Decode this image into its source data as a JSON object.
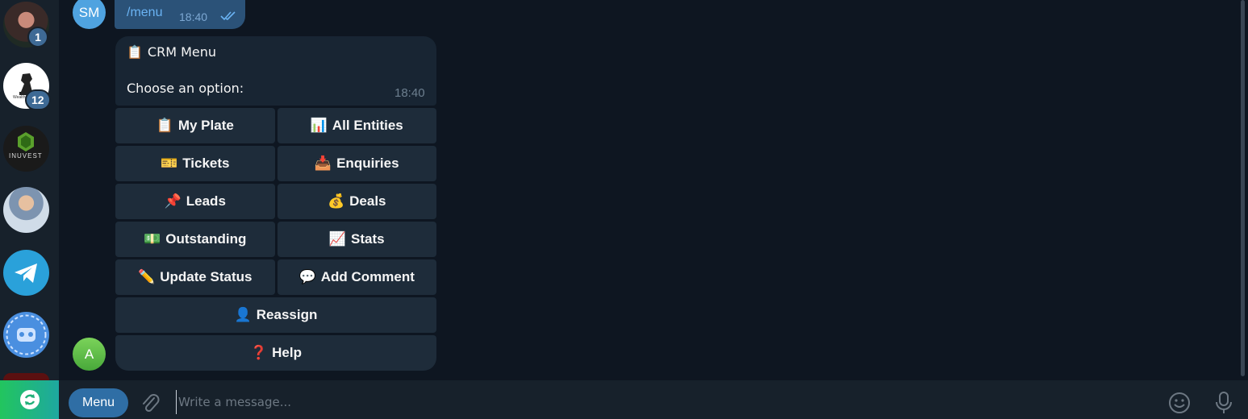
{
  "chat_list": [
    {
      "name": "chat-1",
      "badge": "1"
    },
    {
      "name": "chat-2",
      "badge": "12",
      "logo_text": "Wealth"
    },
    {
      "name": "chat-3",
      "logo_text": "INUVEST"
    },
    {
      "name": "chat-4"
    },
    {
      "name": "telegram"
    },
    {
      "name": "bot"
    }
  ],
  "outgoing": {
    "avatar_initials": "SM",
    "text": "/menu",
    "time": "18:40"
  },
  "incoming": {
    "avatar_initial": "A",
    "title_icon": "📋",
    "title": "CRM Menu",
    "body": "Choose an option:",
    "time": "18:40"
  },
  "keyboard": [
    [
      {
        "icon": "📋",
        "label": "My Plate"
      },
      {
        "icon": "📊",
        "label": "All Entities"
      }
    ],
    [
      {
        "icon": "🎫",
        "label": "Tickets"
      },
      {
        "icon": "📥",
        "label": "Enquiries"
      }
    ],
    [
      {
        "icon": "📌",
        "label": "Leads"
      },
      {
        "icon": "💰",
        "label": "Deals"
      }
    ],
    [
      {
        "icon": "💵",
        "label": "Outstanding"
      },
      {
        "icon": "📈",
        "label": "Stats"
      }
    ],
    [
      {
        "icon": "✏️",
        "label": "Update Status"
      },
      {
        "icon": "💬",
        "label": "Add Comment"
      }
    ],
    [
      {
        "icon": "👤",
        "label": "Reassign"
      }
    ],
    [
      {
        "icon": "❓",
        "label": "Help"
      }
    ]
  ],
  "composer": {
    "menu_label": "Menu",
    "placeholder": "Write a message..."
  },
  "colors": {
    "accent": "#2f6ea5",
    "outgoing_bubble": "#2b5278",
    "incoming_bubble": "#182533",
    "background": "#0e1621"
  }
}
